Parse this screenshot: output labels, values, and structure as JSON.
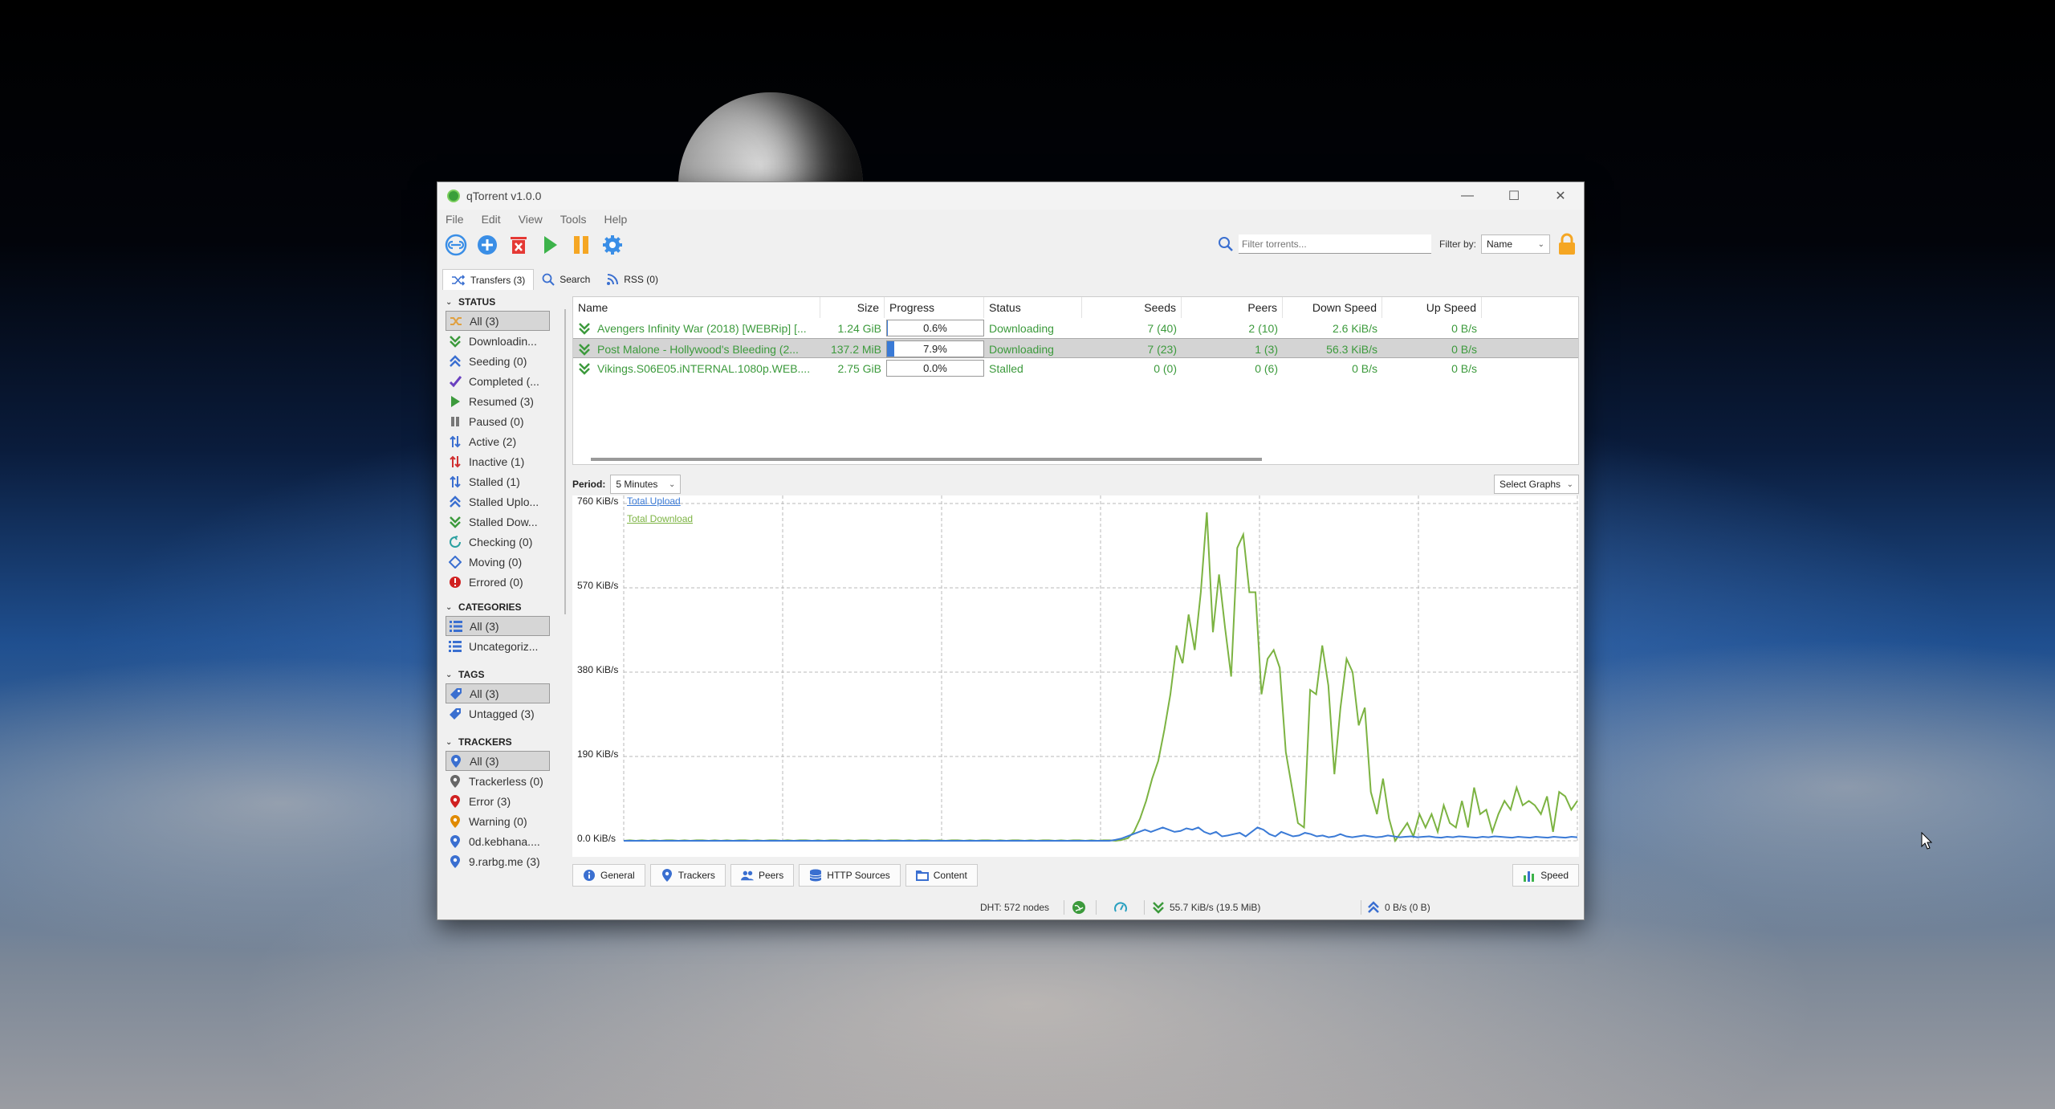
{
  "window": {
    "title": "qTorrent v1.0.0",
    "controls": {
      "minimize": "—",
      "maximize": "☐",
      "close": "✕"
    }
  },
  "menu": [
    "File",
    "Edit",
    "View",
    "Tools",
    "Help"
  ],
  "toolbar": {
    "buttons": [
      "add-link",
      "add-torrent",
      "delete",
      "resume",
      "pause",
      "options"
    ],
    "filter_placeholder": "Filter torrents...",
    "filter_by_label": "Filter by:",
    "filter_by_value": "Name"
  },
  "top_tabs": [
    {
      "label": "Transfers (3)",
      "icon": "shuffle-icon"
    },
    {
      "label": "Search",
      "icon": "search-icon"
    },
    {
      "label": "RSS (0)",
      "icon": "rss-icon"
    }
  ],
  "sidebar": {
    "status_title": "STATUS",
    "status_items": [
      {
        "label": "All (3)",
        "color": "#e0a040"
      },
      {
        "label": "Downloadin...",
        "color": "#3c9a3c"
      },
      {
        "label": "Seeding (0)",
        "color": "#3a6fd0"
      },
      {
        "label": "Completed (...",
        "color": "#6a40c0"
      },
      {
        "label": "Resumed (3)",
        "color": "#3c9a3c"
      },
      {
        "label": "Paused (0)",
        "color": "#777777"
      },
      {
        "label": "Active (2)",
        "color": "#3a6fd0"
      },
      {
        "label": "Inactive (1)",
        "color": "#d03030"
      },
      {
        "label": "Stalled (1)",
        "color": "#3a6fd0"
      },
      {
        "label": "Stalled Uplo...",
        "color": "#3a6fd0"
      },
      {
        "label": "Stalled Dow...",
        "color": "#3c9a3c"
      },
      {
        "label": "Checking (0)",
        "color": "#2aa0a0"
      },
      {
        "label": "Moving (0)",
        "color": "#3a6fd0"
      },
      {
        "label": "Errored (0)",
        "color": "#d02020"
      }
    ],
    "categories_title": "CATEGORIES",
    "categories_items": [
      {
        "label": "All (3)"
      },
      {
        "label": "Uncategoriz..."
      }
    ],
    "tags_title": "TAGS",
    "tags_items": [
      {
        "label": "All (3)"
      },
      {
        "label": "Untagged (3)"
      }
    ],
    "trackers_title": "TRACKERS",
    "trackers_items": [
      {
        "label": "All (3)",
        "color": "#3a6fd0"
      },
      {
        "label": "Trackerless (0)",
        "color": "#666666"
      },
      {
        "label": "Error (3)",
        "color": "#d02020"
      },
      {
        "label": "Warning (0)",
        "color": "#e08a00"
      },
      {
        "label": "0d.kebhana....",
        "color": "#3a6fd0"
      },
      {
        "label": "9.rarbg.me (3)",
        "color": "#3a6fd0"
      }
    ]
  },
  "table": {
    "headers": [
      "Name",
      "Size",
      "Progress",
      "Status",
      "Seeds",
      "Peers",
      "Down Speed",
      "Up Speed"
    ],
    "rows": [
      {
        "name": "Avengers Infinity War (2018) [WEBRip] [...",
        "size": "1.24 GiB",
        "progress": 0.006,
        "progress_text": "0.6%",
        "status": "Downloading",
        "seeds": "7 (40)",
        "peers": "2 (10)",
        "down": "2.6 KiB/s",
        "up": "0 B/s"
      },
      {
        "name": "Post Malone - Hollywood's Bleeding (2...",
        "size": "137.2 MiB",
        "progress": 0.079,
        "progress_text": "7.9%",
        "status": "Downloading",
        "seeds": "7 (23)",
        "peers": "1 (3)",
        "down": "56.3 KiB/s",
        "up": "0 B/s"
      },
      {
        "name": "Vikings.S06E05.iNTERNAL.1080p.WEB....",
        "size": "2.75 GiB",
        "progress": 0.0,
        "progress_text": "0.0%",
        "status": "Stalled",
        "seeds": "0 (0)",
        "peers": "0 (6)",
        "down": "0 B/s",
        "up": "0 B/s"
      }
    ]
  },
  "graph": {
    "period_label": "Period:",
    "period_value": "5 Minutes",
    "select_graphs": "Select Graphs",
    "y_labels": [
      "760 KiB/s",
      "570 KiB/s",
      "380 KiB/s",
      "190 KiB/s",
      "0.0 KiB/s"
    ],
    "legend_upload": "Total Upload",
    "legend_download": "Total Download",
    "upload_color": "#3a7ad6",
    "download_color": "#7cb342",
    "y_max": 760,
    "download_series": [
      0,
      1,
      0,
      1,
      0,
      1,
      0,
      1,
      1,
      0,
      1,
      0,
      1,
      1,
      0,
      1,
      0,
      1,
      0,
      1,
      1,
      0,
      1,
      0,
      1,
      1,
      0,
      1,
      0,
      1,
      1,
      0,
      1,
      0,
      1,
      1,
      0,
      1,
      0,
      1,
      1,
      0,
      1,
      0,
      1,
      1,
      0,
      1,
      0,
      1,
      1,
      0,
      1,
      0,
      1,
      1,
      0,
      1,
      0,
      1,
      1,
      0,
      1,
      0,
      1,
      1,
      0,
      1,
      0,
      1,
      1,
      0,
      1,
      0,
      1,
      1,
      0,
      1,
      0,
      1,
      1,
      0,
      2,
      6,
      20,
      50,
      90,
      140,
      180,
      250,
      330,
      440,
      400,
      510,
      430,
      560,
      740,
      470,
      600,
      480,
      370,
      660,
      690,
      560,
      560,
      330,
      410,
      430,
      390,
      200,
      120,
      40,
      30,
      340,
      330,
      440,
      350,
      150,
      300,
      410,
      380,
      260,
      300,
      110,
      60,
      140,
      50,
      0,
      20,
      40,
      10,
      60,
      30,
      60,
      20,
      80,
      40,
      30,
      90,
      30,
      120,
      60,
      70,
      20,
      60,
      90,
      70,
      120,
      80,
      90,
      80,
      60,
      100,
      20,
      110,
      100,
      70,
      90
    ],
    "upload_series": [
      0,
      0,
      0,
      0,
      0,
      0,
      0,
      0,
      0,
      0,
      0,
      0,
      0,
      0,
      0,
      0,
      0,
      0,
      0,
      0,
      0,
      0,
      0,
      0,
      0,
      0,
      0,
      0,
      0,
      0,
      0,
      0,
      0,
      0,
      0,
      0,
      0,
      0,
      0,
      0,
      0,
      0,
      0,
      0,
      0,
      0,
      0,
      0,
      0,
      0,
      0,
      0,
      0,
      0,
      0,
      0,
      0,
      0,
      0,
      0,
      0,
      0,
      0,
      0,
      0,
      0,
      0,
      0,
      0,
      0,
      0,
      0,
      0,
      0,
      0,
      0,
      0,
      0,
      0,
      0,
      0,
      0,
      0,
      2,
      5,
      10,
      15,
      20,
      25,
      20,
      25,
      30,
      25,
      20,
      22,
      28,
      25,
      30,
      20,
      15,
      20,
      10,
      12,
      15,
      18,
      10,
      20,
      30,
      25,
      15,
      10,
      20,
      15,
      10,
      12,
      18,
      15,
      10,
      12,
      8,
      10,
      15,
      10,
      8,
      10,
      12,
      10,
      8,
      9,
      12,
      10,
      8,
      9,
      10,
      8,
      9,
      10,
      8,
      7,
      9,
      8,
      10,
      9,
      8,
      7,
      9,
      8,
      10,
      9,
      8,
      7,
      9,
      8,
      7,
      9,
      8,
      7,
      9,
      8,
      7,
      9,
      8
    ]
  },
  "bottom_tabs": [
    {
      "label": "General",
      "icon": "info-icon"
    },
    {
      "label": "Trackers",
      "icon": "pin-icon"
    },
    {
      "label": "Peers",
      "icon": "people-icon"
    },
    {
      "label": "HTTP Sources",
      "icon": "server-icon"
    },
    {
      "label": "Content",
      "icon": "folder-icon"
    }
  ],
  "speed_tab": "Speed",
  "statusbar": {
    "dht": "DHT: 572 nodes",
    "download": "55.7 KiB/s (19.5 MiB)",
    "upload": "0 B/s (0 B)"
  }
}
